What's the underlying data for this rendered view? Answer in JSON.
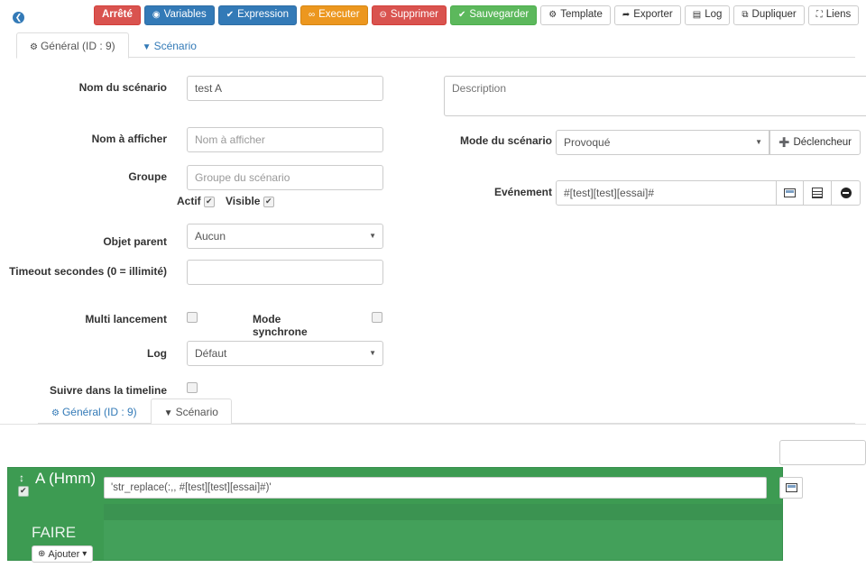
{
  "toolbar": {
    "back_icon": "arrow-circle-left",
    "buttons": [
      {
        "label": "Arrêté",
        "style": "danger",
        "icon": ""
      },
      {
        "label": "Variables",
        "style": "primary",
        "icon": "◉"
      },
      {
        "label": "Expression",
        "style": "primary",
        "icon": "✔"
      },
      {
        "label": "Executer",
        "style": "warning",
        "icon": "∞"
      },
      {
        "label": "Supprimer",
        "style": "delete",
        "icon": "⊖"
      },
      {
        "label": "Sauvegarder",
        "style": "success",
        "icon": "✔"
      },
      {
        "label": "Template",
        "style": "default",
        "icon": "⚙"
      },
      {
        "label": "Exporter",
        "style": "default",
        "icon": "➦"
      },
      {
        "label": "Log",
        "style": "default",
        "icon": "▤"
      },
      {
        "label": "Dupliquer",
        "style": "default",
        "icon": "⧉"
      },
      {
        "label": "Liens",
        "style": "default",
        "icon": "⛶"
      }
    ]
  },
  "tabs_top": [
    {
      "label": "Général (ID : 9)",
      "icon": "⚙",
      "active": true
    },
    {
      "label": "Scénario",
      "icon": "▼",
      "active": false
    }
  ],
  "tabs_bottom": [
    {
      "label": "Général (ID : 9)",
      "icon": "⚙",
      "active": false
    },
    {
      "label": "Scénario",
      "icon": "▼",
      "active": true
    }
  ],
  "form": {
    "scenario_name": {
      "label": "Nom du scénario",
      "value": "test A",
      "placeholder": ""
    },
    "display_name": {
      "label": "Nom à afficher",
      "value": "",
      "placeholder": "Nom à afficher"
    },
    "group": {
      "label": "Groupe",
      "value": "",
      "placeholder": "Groupe du scénario"
    },
    "actif": {
      "label": "Actif",
      "checked": true
    },
    "visible": {
      "label": "Visible",
      "checked": true
    },
    "parent_object": {
      "label": "Objet parent",
      "value": "Aucun"
    },
    "timeout": {
      "label": "Timeout secondes (0 = illimité)",
      "value": "",
      "placeholder": ""
    },
    "multi_launch": {
      "label": "Multi lancement",
      "checked": false
    },
    "sync_mode": {
      "label": "Mode synchrone",
      "checked": false
    },
    "log": {
      "label": "Log",
      "value": "Défaut"
    },
    "timeline": {
      "label": "Suivre dans la timeline",
      "checked": false
    },
    "description": {
      "placeholder": "Description",
      "value": ""
    },
    "scenario_mode": {
      "label": "Mode du scénario",
      "value": "Provoqué",
      "trigger_button": "Déclencheur",
      "trigger_icon": "➕"
    },
    "event": {
      "label": "Evénement",
      "value": "#[test][test][essai]#",
      "buttons": [
        {
          "icon": "window-icon"
        },
        {
          "icon": "calculator-icon"
        },
        {
          "icon": "minus-circle-icon"
        }
      ]
    }
  },
  "scenario_block": {
    "move_icon": "↕",
    "checked": true,
    "title": "A (Hmm)",
    "do_label": "FAIRE",
    "add_button": {
      "label": "Ajouter",
      "icon": "⊕",
      "caret": "▾"
    },
    "expression": "'str_replace(:,, #[test][test][essai]#)'",
    "expression_button_icon": "window-icon"
  },
  "colors": {
    "danger": "#d9534f",
    "primary": "#337ab7",
    "warning": "#ec971f",
    "success": "#5cb85c",
    "scenario_green": "#3d9b52",
    "scenario_green_light": "#43a05a"
  }
}
